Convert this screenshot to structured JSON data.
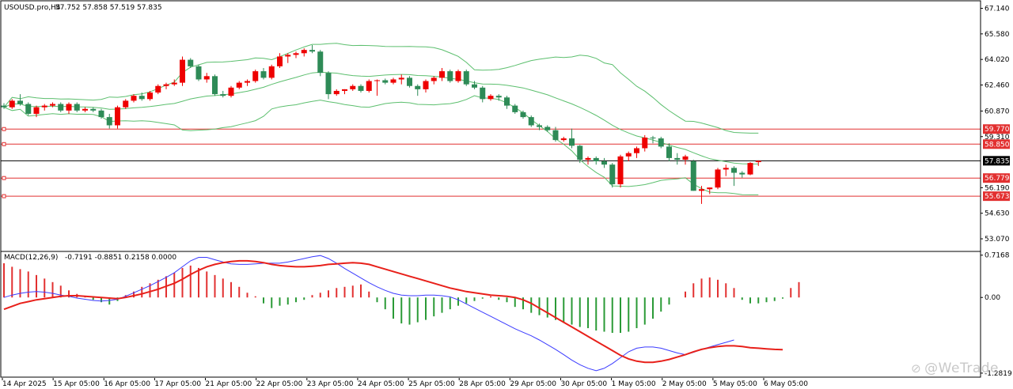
{
  "header": {
    "symbol_line": "USOUSD.pro,H4",
    "ohlc_line": "57.752 57.858 57.519 57.835"
  },
  "macd_header": {
    "name": "MACD(12,26,9)",
    "values": "-0.7191 -0.8851 0.2158 0.0000"
  },
  "watermark": "@WeTrade",
  "colors": {
    "bull": "#2e8b57",
    "bear": "#ee0000",
    "band": "#5cbf6e",
    "level": "#e23030",
    "macd_main": "#e8201a",
    "macd_signal": "#3b3bff",
    "macd_hist_pos": "#e23030",
    "macd_hist_neg": "#2a9a36",
    "grid_frame": "#000000"
  },
  "chart_data": [
    {
      "type": "candlestick",
      "title": "USOUSD.pro,H4",
      "price_scale": [
        "67.140",
        "65.580",
        "64.020",
        "62.460",
        "60.870",
        "59.310",
        "56.190",
        "54.630",
        "53.070"
      ],
      "ylim": [
        52.3,
        67.6
      ],
      "x_labels": [
        "14 Apr 2025",
        "15 Apr 05:00",
        "16 Apr 05:00",
        "17 Apr 05:00",
        "21 Apr 05:00",
        "22 Apr 05:00",
        "23 Apr 05:00",
        "24 Apr 05:00",
        "25 Apr 05:00",
        "28 Apr 05:00",
        "29 Apr 05:00",
        "30 Apr 05:00",
        "1 May 05:00",
        "2 May 05:00",
        "5 May 05:00",
        "6 May 05:00"
      ],
      "levels": [
        {
          "label": "59.770",
          "value": 59.77,
          "kind": "resistance"
        },
        {
          "label": "58.850",
          "value": 58.85,
          "kind": "resistance"
        },
        {
          "label": "57.835",
          "value": 57.835,
          "kind": "current"
        },
        {
          "label": "56.779",
          "value": 56.779,
          "kind": "support"
        },
        {
          "label": "55.673",
          "value": 55.673,
          "kind": "support"
        }
      ],
      "candles": [
        [
          61.2,
          61.35,
          61.0,
          61.1
        ],
        [
          61.1,
          61.6,
          61.0,
          61.5
        ],
        [
          61.5,
          61.9,
          61.2,
          61.3
        ],
        [
          61.3,
          61.4,
          60.6,
          60.7
        ],
        [
          60.7,
          61.2,
          60.5,
          61.1
        ],
        [
          61.1,
          61.3,
          60.9,
          61.2
        ],
        [
          61.2,
          61.4,
          61.1,
          61.3
        ],
        [
          61.3,
          61.4,
          60.8,
          60.9
        ],
        [
          60.9,
          61.4,
          60.7,
          61.3
        ],
        [
          61.3,
          61.4,
          60.8,
          60.9
        ],
        [
          60.9,
          61.1,
          60.8,
          61.0
        ],
        [
          61.0,
          61.1,
          60.8,
          60.9
        ],
        [
          60.9,
          61.0,
          60.4,
          60.5
        ],
        [
          60.5,
          60.7,
          59.8,
          60.0
        ],
        [
          60.0,
          61.2,
          59.8,
          61.1
        ],
        [
          61.1,
          61.6,
          61.0,
          61.5
        ],
        [
          61.5,
          61.9,
          61.4,
          61.8
        ],
        [
          61.8,
          62.0,
          61.5,
          61.6
        ],
        [
          61.6,
          62.1,
          61.5,
          62.0
        ],
        [
          62.0,
          62.5,
          61.9,
          62.4
        ],
        [
          62.4,
          62.6,
          62.2,
          62.5
        ],
        [
          62.5,
          62.8,
          62.4,
          62.6
        ],
        [
          62.6,
          64.2,
          62.4,
          64.0
        ],
        [
          64.0,
          64.1,
          63.5,
          63.6
        ],
        [
          63.6,
          63.7,
          62.7,
          62.8
        ],
        [
          62.8,
          63.2,
          62.6,
          63.0
        ],
        [
          63.0,
          63.1,
          61.8,
          61.9
        ],
        [
          61.9,
          62.1,
          61.7,
          61.8
        ],
        [
          61.8,
          62.4,
          61.7,
          62.3
        ],
        [
          62.3,
          62.7,
          62.2,
          62.6
        ],
        [
          62.6,
          62.8,
          62.4,
          62.7
        ],
        [
          62.7,
          63.4,
          62.6,
          63.3
        ],
        [
          63.3,
          63.5,
          62.8,
          62.9
        ],
        [
          62.9,
          63.7,
          62.8,
          63.6
        ],
        [
          63.6,
          64.4,
          63.5,
          64.2
        ],
        [
          64.2,
          64.4,
          63.8,
          64.3
        ],
        [
          64.3,
          64.5,
          64.1,
          64.4
        ],
        [
          64.4,
          64.7,
          64.2,
          64.6
        ],
        [
          64.6,
          64.9,
          64.4,
          64.5
        ],
        [
          64.5,
          64.6,
          63.0,
          63.2
        ],
        [
          63.2,
          63.3,
          61.6,
          61.9
        ],
        [
          61.9,
          62.2,
          61.8,
          62.1
        ],
        [
          62.1,
          62.2,
          61.9,
          62.2
        ],
        [
          62.2,
          62.5,
          62.1,
          62.4
        ],
        [
          62.4,
          62.5,
          62.0,
          62.1
        ],
        [
          62.1,
          62.8,
          62.0,
          62.7
        ],
        [
          62.7,
          62.8,
          61.8,
          62.75
        ],
        [
          62.75,
          62.85,
          62.5,
          62.6
        ],
        [
          62.6,
          62.9,
          62.5,
          62.8
        ],
        [
          62.8,
          63.1,
          62.5,
          62.9
        ],
        [
          62.9,
          63.0,
          62.3,
          62.4
        ],
        [
          62.4,
          62.5,
          61.8,
          62.2
        ],
        [
          62.2,
          62.8,
          62.0,
          62.7
        ],
        [
          62.7,
          63.0,
          62.5,
          62.9
        ],
        [
          62.9,
          63.5,
          62.7,
          63.3
        ],
        [
          63.3,
          63.4,
          62.6,
          62.7
        ],
        [
          62.7,
          63.4,
          62.6,
          63.3
        ],
        [
          63.3,
          63.4,
          62.4,
          62.5
        ],
        [
          62.5,
          62.7,
          62.2,
          62.3
        ],
        [
          62.3,
          62.4,
          61.4,
          61.6
        ],
        [
          61.6,
          61.9,
          61.5,
          61.8
        ],
        [
          61.8,
          61.9,
          61.5,
          61.7
        ],
        [
          61.7,
          61.8,
          61.0,
          61.2
        ],
        [
          61.2,
          61.3,
          60.7,
          60.8
        ],
        [
          60.8,
          60.9,
          60.4,
          60.5
        ],
        [
          60.5,
          60.6,
          59.9,
          60.0
        ],
        [
          60.0,
          60.1,
          59.7,
          59.9
        ],
        [
          59.9,
          60.0,
          59.6,
          59.7
        ],
        [
          59.7,
          59.9,
          59.0,
          59.1
        ],
        [
          59.1,
          59.3,
          59.0,
          59.2
        ],
        [
          59.2,
          59.8,
          58.6,
          58.75
        ],
        [
          58.75,
          58.8,
          57.7,
          57.9
        ],
        [
          57.9,
          58.1,
          57.6,
          58.0
        ],
        [
          58.0,
          58.1,
          57.6,
          57.8
        ],
        [
          57.8,
          58.0,
          57.4,
          57.6
        ],
        [
          57.6,
          57.7,
          56.2,
          56.4
        ],
        [
          56.4,
          58.2,
          56.2,
          58.1
        ],
        [
          58.1,
          58.4,
          57.8,
          58.3
        ],
        [
          58.3,
          58.7,
          58.0,
          58.6
        ],
        [
          58.6,
          59.4,
          58.4,
          59.25
        ],
        [
          59.25,
          59.35,
          58.9,
          59.2
        ],
        [
          59.2,
          59.3,
          58.6,
          58.7
        ],
        [
          58.7,
          58.9,
          57.8,
          58.0
        ],
        [
          58.0,
          58.3,
          57.6,
          57.9
        ],
        [
          57.9,
          58.2,
          57.6,
          58.1
        ],
        [
          57.8,
          57.9,
          56.0,
          56.0
        ],
        [
          56.0,
          56.3,
          55.2,
          56.1
        ],
        [
          56.1,
          56.2,
          55.8,
          56.2
        ],
        [
          56.2,
          57.4,
          56.1,
          57.3
        ],
        [
          57.3,
          57.6,
          56.9,
          57.4
        ],
        [
          57.4,
          57.5,
          56.3,
          57.1
        ],
        [
          57.1,
          57.2,
          56.8,
          57.0
        ],
        [
          57.0,
          57.75,
          56.95,
          57.7
        ],
        [
          57.752,
          57.858,
          57.519,
          57.835
        ]
      ]
    },
    {
      "type": "macd",
      "title": "MACD(12,26,9)",
      "values": {
        "main": -0.7191,
        "signal": -0.8851,
        "histogram": 0.2158,
        "extra": 0.0
      },
      "scale_labels": [
        "0.7168",
        "0.00",
        "-1.2819"
      ],
      "ylim": [
        -1.35,
        0.78
      ],
      "histogram": [
        0.58,
        0.52,
        0.48,
        0.44,
        0.38,
        0.32,
        0.26,
        0.2,
        0.12,
        0.06,
        0.02,
        -0.04,
        -0.08,
        -0.12,
        -0.06,
        0.04,
        0.1,
        0.18,
        0.24,
        0.3,
        0.36,
        0.42,
        0.5,
        0.54,
        0.5,
        0.44,
        0.38,
        0.32,
        0.26,
        0.18,
        0.08,
        0.02,
        -0.1,
        -0.18,
        -0.14,
        -0.12,
        -0.08,
        -0.04,
        0.04,
        0.08,
        0.12,
        0.16,
        0.18,
        0.2,
        0.22,
        0.1,
        -0.08,
        -0.2,
        -0.36,
        -0.44,
        -0.46,
        -0.42,
        -0.38,
        -0.32,
        -0.26,
        -0.2,
        -0.14,
        -0.1,
        -0.06,
        -0.02,
        0.02,
        -0.04,
        -0.08,
        -0.16,
        -0.2,
        -0.26,
        -0.3,
        -0.34,
        -0.38,
        -0.42,
        -0.46,
        -0.5,
        -0.52,
        -0.56,
        -0.58,
        -0.6,
        -0.6,
        -0.58,
        -0.52,
        -0.46,
        -0.36,
        -0.24,
        -0.12,
        0.0,
        0.1,
        0.24,
        0.32,
        0.34,
        0.3,
        0.24,
        0.16,
        -0.04,
        -0.1,
        -0.1,
        -0.08,
        -0.06,
        -0.02,
        0.16,
        0.26
      ],
      "main": [
        -0.2,
        -0.15,
        -0.1,
        -0.07,
        -0.04,
        -0.02,
        0.0,
        0.02,
        0.03,
        0.03,
        0.02,
        0.01,
        0.0,
        -0.01,
        -0.02,
        0.0,
        0.03,
        0.06,
        0.1,
        0.14,
        0.19,
        0.24,
        0.31,
        0.39,
        0.46,
        0.52,
        0.56,
        0.59,
        0.61,
        0.62,
        0.62,
        0.61,
        0.59,
        0.56,
        0.54,
        0.53,
        0.52,
        0.52,
        0.53,
        0.54,
        0.56,
        0.57,
        0.58,
        0.59,
        0.58,
        0.56,
        0.52,
        0.48,
        0.44,
        0.4,
        0.36,
        0.32,
        0.28,
        0.24,
        0.2,
        0.16,
        0.13,
        0.1,
        0.08,
        0.06,
        0.04,
        0.03,
        0.02,
        0.0,
        -0.04,
        -0.1,
        -0.18,
        -0.26,
        -0.34,
        -0.42,
        -0.5,
        -0.58,
        -0.66,
        -0.74,
        -0.82,
        -0.9,
        -0.98,
        -1.04,
        -1.08,
        -1.1,
        -1.1,
        -1.08,
        -1.05,
        -1.01,
        -0.97,
        -0.92,
        -0.88,
        -0.85,
        -0.83,
        -0.82,
        -0.82,
        -0.83,
        -0.85,
        -0.86,
        -0.87,
        -0.88,
        -0.885
      ],
      "signal": [
        0.0,
        0.04,
        0.07,
        0.09,
        0.1,
        0.09,
        0.07,
        0.04,
        0.02,
        -0.01,
        -0.03,
        -0.05,
        -0.06,
        -0.05,
        -0.03,
        0.02,
        0.08,
        0.14,
        0.2,
        0.27,
        0.34,
        0.42,
        0.52,
        0.62,
        0.68,
        0.68,
        0.64,
        0.6,
        0.57,
        0.56,
        0.56,
        0.57,
        0.58,
        0.58,
        0.58,
        0.6,
        0.63,
        0.66,
        0.69,
        0.71,
        0.66,
        0.58,
        0.49,
        0.41,
        0.33,
        0.25,
        0.18,
        0.12,
        0.07,
        0.04,
        0.03,
        0.03,
        0.04,
        0.04,
        0.03,
        0.01,
        -0.04,
        -0.11,
        -0.18,
        -0.25,
        -0.32,
        -0.39,
        -0.46,
        -0.53,
        -0.59,
        -0.65,
        -0.72,
        -0.8,
        -0.88,
        -0.97,
        -1.06,
        -1.14,
        -1.2,
        -1.24,
        -1.2,
        -1.12,
        -1.02,
        -0.92,
        -0.86,
        -0.84,
        -0.84,
        -0.86,
        -0.9,
        -0.94,
        -0.97,
        -0.93,
        -0.88,
        -0.84,
        -0.8,
        -0.76,
        -0.72
      ]
    }
  ]
}
